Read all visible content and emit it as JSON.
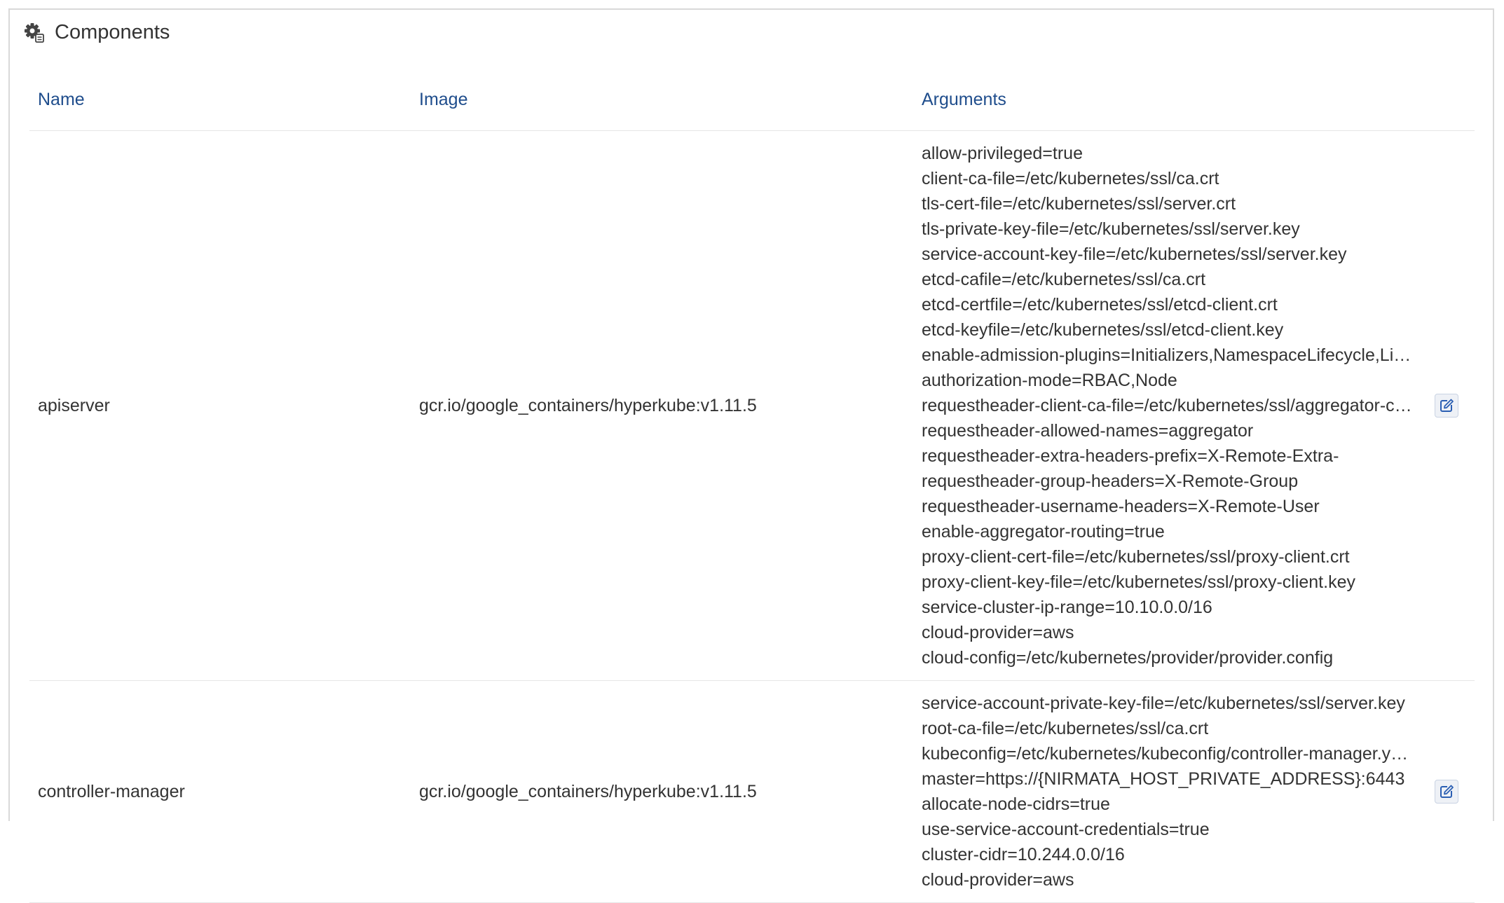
{
  "panel": {
    "title": "Components",
    "icon": "gear-icon"
  },
  "table": {
    "headers": {
      "name": "Name",
      "image": "Image",
      "arguments": "Arguments"
    },
    "rows": [
      {
        "name": "apiserver",
        "image": "gcr.io/google_containers/hyperkube:v1.11.5",
        "arguments": [
          "allow-privileged=true",
          "client-ca-file=/etc/kubernetes/ssl/ca.crt",
          "tls-cert-file=/etc/kubernetes/ssl/server.crt",
          "tls-private-key-file=/etc/kubernetes/ssl/server.key",
          "service-account-key-file=/etc/kubernetes/ssl/server.key",
          "etcd-cafile=/etc/kubernetes/ssl/ca.crt",
          "etcd-certfile=/etc/kubernetes/ssl/etcd-client.crt",
          "etcd-keyfile=/etc/kubernetes/ssl/etcd-client.key",
          "enable-admission-plugins=Initializers,NamespaceLifecycle,Limit...",
          "authorization-mode=RBAC,Node",
          "requestheader-client-ca-file=/etc/kubernetes/ssl/aggregator-ca....",
          "requestheader-allowed-names=aggregator",
          "requestheader-extra-headers-prefix=X-Remote-Extra-",
          "requestheader-group-headers=X-Remote-Group",
          "requestheader-username-headers=X-Remote-User",
          "enable-aggregator-routing=true",
          "proxy-client-cert-file=/etc/kubernetes/ssl/proxy-client.crt",
          "proxy-client-key-file=/etc/kubernetes/ssl/proxy-client.key",
          "service-cluster-ip-range=10.10.0.0/16",
          "cloud-provider=aws",
          "cloud-config=/etc/kubernetes/provider/provider.config"
        ]
      },
      {
        "name": "controller-manager",
        "image": "gcr.io/google_containers/hyperkube:v1.11.5",
        "arguments": [
          "service-account-private-key-file=/etc/kubernetes/ssl/server.key",
          "root-ca-file=/etc/kubernetes/ssl/ca.crt",
          "kubeconfig=/etc/kubernetes/kubeconfig/controller-manager.ya...",
          "master=https://{NIRMATA_HOST_PRIVATE_ADDRESS}:6443",
          "allocate-node-cidrs=true",
          "use-service-account-credentials=true",
          "cluster-cidr=10.244.0.0/16",
          "cloud-provider=aws"
        ]
      }
    ]
  },
  "colors": {
    "header_text": "#1f4d8c",
    "edit_icon": "#2b5fb3"
  }
}
